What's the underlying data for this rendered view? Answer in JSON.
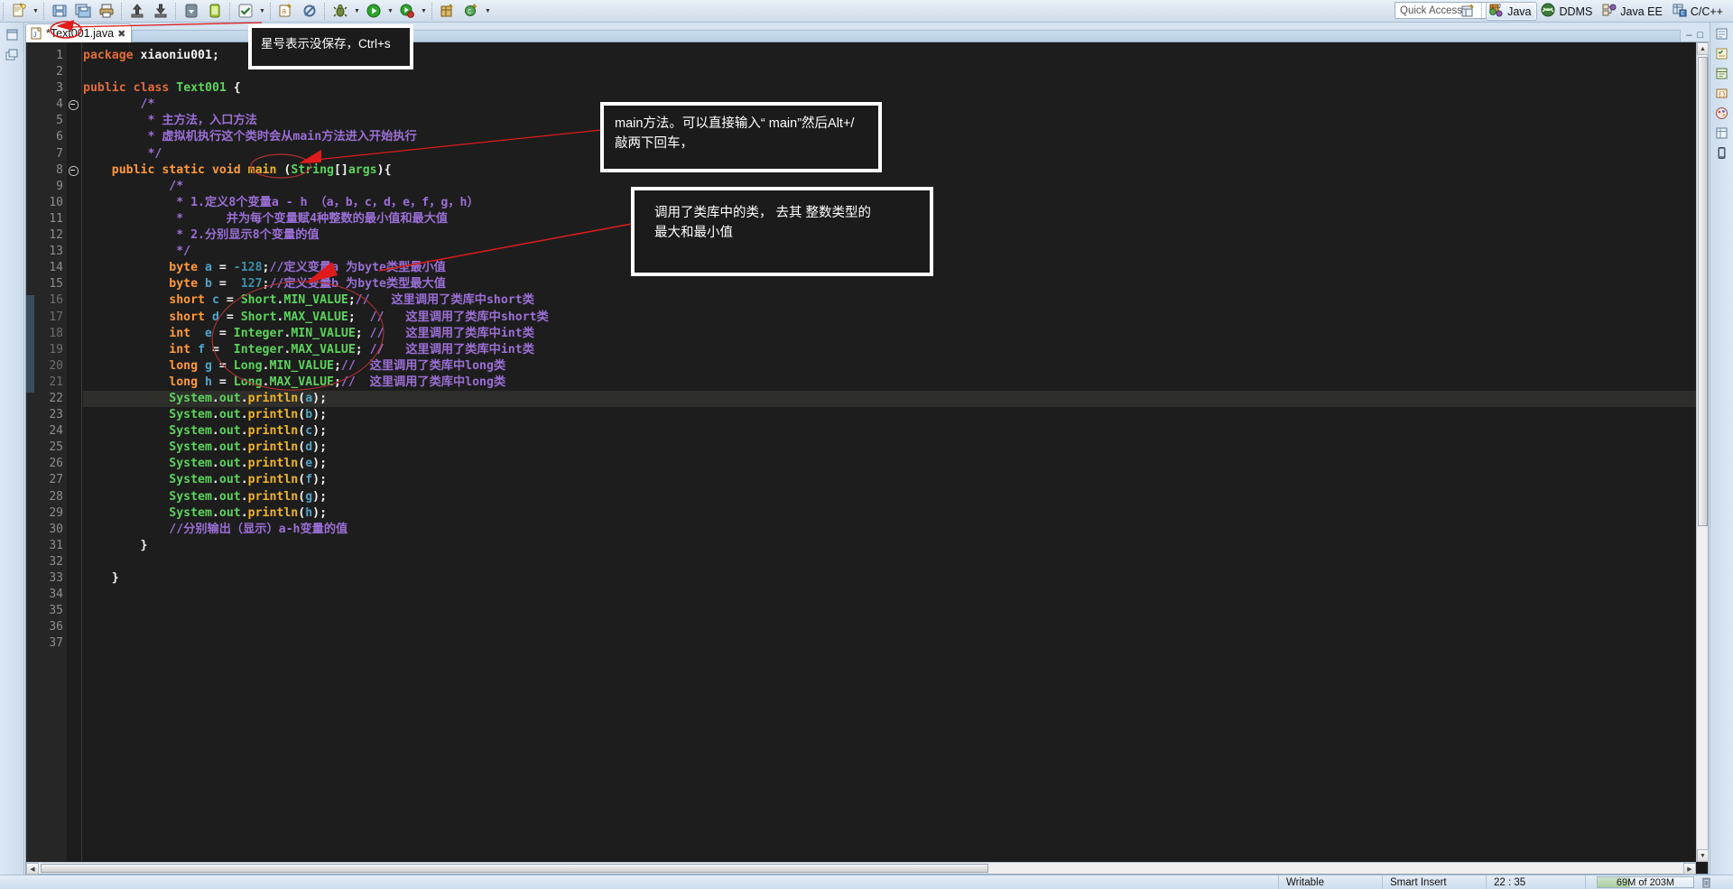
{
  "window": {
    "quick_access_placeholder": "Quick Access"
  },
  "toolbar": {
    "buttons": [
      {
        "name": "new-wizard-icon",
        "label": "New"
      },
      {
        "name": "new-dropdown-icon",
        "label": "New dropdown"
      },
      {
        "name": "save-icon",
        "label": "Save"
      },
      {
        "name": "save-all-icon",
        "label": "Save All"
      },
      {
        "name": "print-icon",
        "label": "Print"
      },
      {
        "name": "export-icon",
        "label": "Export"
      },
      {
        "name": "import-icon",
        "label": "Import"
      },
      {
        "name": "android-sdk-manager-icon",
        "label": "Android SDK Manager"
      },
      {
        "name": "android-virtual-device-manager-icon",
        "label": "Android Virtual Device Manager"
      },
      {
        "name": "build-all-icon",
        "label": "Build All"
      },
      {
        "name": "build-dropdown-icon",
        "label": "Build dropdown"
      },
      {
        "name": "new-android-project-icon",
        "label": "New Android Project"
      },
      {
        "name": "skip-breakpoints-icon",
        "label": "Skip All Breakpoints"
      },
      {
        "name": "debug-icon",
        "label": "Debug"
      },
      {
        "name": "debug-dropdown-icon",
        "label": "Debug dropdown"
      },
      {
        "name": "run-icon",
        "label": "Run"
      },
      {
        "name": "run-dropdown-icon",
        "label": "Run dropdown"
      },
      {
        "name": "run-external-tools-icon",
        "label": "External Tools"
      },
      {
        "name": "external-tools-dropdown-icon",
        "label": "External Tools dropdown"
      },
      {
        "name": "new-java-package-icon",
        "label": "New Java Package"
      },
      {
        "name": "new-java-class-icon",
        "label": "New Java Class"
      },
      {
        "name": "class-dropdown-icon",
        "label": "New Class dropdown"
      }
    ]
  },
  "perspectives": {
    "open_perspective_label": "Open Perspective",
    "items": [
      {
        "label": "Java",
        "icon": "java-perspective-icon",
        "active": true
      },
      {
        "label": "DDMS",
        "icon": "ddms-perspective-icon",
        "active": false
      },
      {
        "label": "Java EE",
        "icon": "javaee-perspective-icon",
        "active": false
      },
      {
        "label": "C/C++",
        "icon": "cpp-perspective-icon",
        "active": false
      }
    ]
  },
  "left_rail": {
    "items": [
      {
        "name": "restore-view-icon",
        "label": "Restore"
      },
      {
        "name": "package-explorer-minimized-icon",
        "label": "Package Explorer"
      }
    ]
  },
  "right_rail": {
    "items": [
      {
        "name": "outline-view-icon",
        "label": "Outline"
      },
      {
        "name": "task-list-icon",
        "label": "Task List"
      },
      {
        "name": "templates-view-icon",
        "label": "Templates"
      },
      {
        "name": "snippets-view-icon",
        "label": "Snippets"
      },
      {
        "name": "palette-view-icon",
        "label": "Palette"
      },
      {
        "name": "properties-view-icon",
        "label": "Properties"
      },
      {
        "name": "device-view-icon",
        "label": "Devices"
      }
    ]
  },
  "editor": {
    "tab": {
      "filename": "*Text001.java",
      "close_label": "✖",
      "icon": "java-file-icon"
    },
    "minimize_label": "–",
    "maximize_label": "□",
    "current_line": 22,
    "lines": [
      {
        "n": 1,
        "segs": [
          {
            "t": "package",
            "c": "kw2"
          },
          {
            "t": " ",
            "c": "pln"
          },
          {
            "t": "xiaoniu001",
            "c": "wht"
          },
          {
            "t": ";",
            "c": "wht"
          }
        ]
      },
      {
        "n": 2,
        "segs": []
      },
      {
        "n": 3,
        "segs": [
          {
            "t": "public",
            "c": "kw2"
          },
          {
            "t": " ",
            "c": "pln"
          },
          {
            "t": "class",
            "c": "kw2"
          },
          {
            "t": " ",
            "c": "pln"
          },
          {
            "t": "Text001",
            "c": "grn"
          },
          {
            "t": " {",
            "c": "wht"
          }
        ]
      },
      {
        "n": 4,
        "fold": true,
        "segs": [
          {
            "t": "\t\t/*",
            "c": "cmt"
          }
        ]
      },
      {
        "n": 5,
        "segs": [
          {
            "t": "\t\t * 主方法，入口方法",
            "c": "cmt"
          }
        ]
      },
      {
        "n": 6,
        "segs": [
          {
            "t": "\t\t * 虚拟机执行这个类时会从main方法进入开始执行",
            "c": "cmt"
          }
        ]
      },
      {
        "n": 7,
        "segs": [
          {
            "t": "\t\t */",
            "c": "cmt"
          }
        ]
      },
      {
        "n": 8,
        "fold": true,
        "segs": [
          {
            "t": "\t",
            "c": "pln"
          },
          {
            "t": "public",
            "c": "kw"
          },
          {
            "t": " ",
            "c": "pln"
          },
          {
            "t": "static",
            "c": "kw"
          },
          {
            "t": " ",
            "c": "pln"
          },
          {
            "t": "void",
            "c": "kw"
          },
          {
            "t": " ",
            "c": "pln"
          },
          {
            "t": "main",
            "c": "mth"
          },
          {
            "t": " (",
            "c": "wht"
          },
          {
            "t": "String",
            "c": "grn"
          },
          {
            "t": "[]",
            "c": "wht"
          },
          {
            "t": "args",
            "c": "grn"
          },
          {
            "t": "){",
            "c": "wht"
          }
        ]
      },
      {
        "n": 9,
        "segs": [
          {
            "t": "\t\t\t/*",
            "c": "cmt"
          }
        ]
      },
      {
        "n": 10,
        "segs": [
          {
            "t": "\t\t\t * 1.定义8个变量a - h （a，b，c，d，e，f，g，h）",
            "c": "cmt"
          }
        ]
      },
      {
        "n": 11,
        "segs": [
          {
            "t": "\t\t\t *      并为每个变量赋4种整数的最小值和最大值",
            "c": "cmt"
          }
        ]
      },
      {
        "n": 12,
        "segs": [
          {
            "t": "\t\t\t * 2.分别显示8个变量的值",
            "c": "cmt"
          }
        ]
      },
      {
        "n": 13,
        "segs": [
          {
            "t": "\t\t\t */",
            "c": "cmt"
          }
        ]
      },
      {
        "n": 14,
        "segs": [
          {
            "t": "\t\t\t",
            "c": "pln"
          },
          {
            "t": "byte",
            "c": "kw"
          },
          {
            "t": " ",
            "c": "pln"
          },
          {
            "t": "a",
            "c": "var"
          },
          {
            "t": " = ",
            "c": "wht"
          },
          {
            "t": "-128",
            "c": "num"
          },
          {
            "t": ";",
            "c": "wht"
          },
          {
            "t": "//定义变量a 为byte类型最小值",
            "c": "cmt"
          }
        ]
      },
      {
        "n": 15,
        "segs": [
          {
            "t": "\t\t\t",
            "c": "pln"
          },
          {
            "t": "byte",
            "c": "kw"
          },
          {
            "t": " ",
            "c": "pln"
          },
          {
            "t": "b",
            "c": "var"
          },
          {
            "t": " =  ",
            "c": "wht"
          },
          {
            "t": "127",
            "c": "num"
          },
          {
            "t": ";",
            "c": "wht"
          },
          {
            "t": "//定义变量b 为byte类型最大值",
            "c": "cmt"
          }
        ]
      },
      {
        "n": 16,
        "segs": [
          {
            "t": "\t\t\t",
            "c": "pln"
          },
          {
            "t": "short",
            "c": "kw"
          },
          {
            "t": " ",
            "c": "pln"
          },
          {
            "t": "c",
            "c": "var"
          },
          {
            "t": " = ",
            "c": "wht"
          },
          {
            "t": "Short",
            "c": "grn"
          },
          {
            "t": ".",
            "c": "wht"
          },
          {
            "t": "MIN_VALUE",
            "c": "grn"
          },
          {
            "t": ";",
            "c": "wht"
          },
          {
            "t": "//   这里调用了类库中short类",
            "c": "cmt"
          }
        ]
      },
      {
        "n": 17,
        "segs": [
          {
            "t": "\t\t\t",
            "c": "pln"
          },
          {
            "t": "short",
            "c": "kw"
          },
          {
            "t": " ",
            "c": "pln"
          },
          {
            "t": "d",
            "c": "var"
          },
          {
            "t": " = ",
            "c": "wht"
          },
          {
            "t": "Short",
            "c": "grn"
          },
          {
            "t": ".",
            "c": "wht"
          },
          {
            "t": "MAX_VALUE",
            "c": "grn"
          },
          {
            "t": ";  ",
            "c": "wht"
          },
          {
            "t": "//   这里调用了类库中short类",
            "c": "cmt"
          }
        ]
      },
      {
        "n": 18,
        "segs": [
          {
            "t": "\t\t\t",
            "c": "pln"
          },
          {
            "t": "int",
            "c": "kw"
          },
          {
            "t": "  ",
            "c": "pln"
          },
          {
            "t": "e",
            "c": "var"
          },
          {
            "t": " = ",
            "c": "wht"
          },
          {
            "t": "Integer",
            "c": "grn"
          },
          {
            "t": ".",
            "c": "wht"
          },
          {
            "t": "MIN_VALUE",
            "c": "grn"
          },
          {
            "t": "; ",
            "c": "wht"
          },
          {
            "t": "//   这里调用了类库中int类",
            "c": "cmt"
          }
        ]
      },
      {
        "n": 19,
        "segs": [
          {
            "t": "\t\t\t",
            "c": "pln"
          },
          {
            "t": "int",
            "c": "kw"
          },
          {
            "t": " ",
            "c": "pln"
          },
          {
            "t": "f",
            "c": "var"
          },
          {
            "t": " =  ",
            "c": "wht"
          },
          {
            "t": "Integer",
            "c": "grn"
          },
          {
            "t": ".",
            "c": "wht"
          },
          {
            "t": "MAX_VALUE",
            "c": "grn"
          },
          {
            "t": "; ",
            "c": "wht"
          },
          {
            "t": "//   这里调用了类库中int类",
            "c": "cmt"
          }
        ]
      },
      {
        "n": 20,
        "segs": [
          {
            "t": "\t\t\t",
            "c": "pln"
          },
          {
            "t": "long",
            "c": "kw"
          },
          {
            "t": " ",
            "c": "pln"
          },
          {
            "t": "g",
            "c": "var"
          },
          {
            "t": " = ",
            "c": "wht"
          },
          {
            "t": "Long",
            "c": "grn"
          },
          {
            "t": ".",
            "c": "wht"
          },
          {
            "t": "MIN_VALUE",
            "c": "grn"
          },
          {
            "t": ";",
            "c": "wht"
          },
          {
            "t": "//  这里调用了类库中long类",
            "c": "cmt"
          }
        ]
      },
      {
        "n": 21,
        "segs": [
          {
            "t": "\t\t\t",
            "c": "pln"
          },
          {
            "t": "long",
            "c": "kw"
          },
          {
            "t": " ",
            "c": "pln"
          },
          {
            "t": "h",
            "c": "var"
          },
          {
            "t": " = ",
            "c": "wht"
          },
          {
            "t": "Long",
            "c": "grn"
          },
          {
            "t": ".",
            "c": "wht"
          },
          {
            "t": "MAX_VALUE",
            "c": "grn"
          },
          {
            "t": ";",
            "c": "wht"
          },
          {
            "t": "//  这里调用了类库中long类",
            "c": "cmt"
          }
        ]
      },
      {
        "n": 22,
        "cur": true,
        "segs": [
          {
            "t": "\t\t\t",
            "c": "pln"
          },
          {
            "t": "System",
            "c": "grn"
          },
          {
            "t": ".",
            "c": "wht"
          },
          {
            "t": "out",
            "c": "grn"
          },
          {
            "t": ".",
            "c": "wht"
          },
          {
            "t": "println",
            "c": "mth"
          },
          {
            "t": "(",
            "c": "wht"
          },
          {
            "t": "a",
            "c": "var"
          },
          {
            "t": ");",
            "c": "wht"
          }
        ]
      },
      {
        "n": 23,
        "segs": [
          {
            "t": "\t\t\t",
            "c": "pln"
          },
          {
            "t": "System",
            "c": "grn"
          },
          {
            "t": ".",
            "c": "wht"
          },
          {
            "t": "out",
            "c": "grn"
          },
          {
            "t": ".",
            "c": "wht"
          },
          {
            "t": "println",
            "c": "mth"
          },
          {
            "t": "(",
            "c": "wht"
          },
          {
            "t": "b",
            "c": "var"
          },
          {
            "t": ");",
            "c": "wht"
          }
        ]
      },
      {
        "n": 24,
        "segs": [
          {
            "t": "\t\t\t",
            "c": "pln"
          },
          {
            "t": "System",
            "c": "grn"
          },
          {
            "t": ".",
            "c": "wht"
          },
          {
            "t": "out",
            "c": "grn"
          },
          {
            "t": ".",
            "c": "wht"
          },
          {
            "t": "println",
            "c": "mth"
          },
          {
            "t": "(",
            "c": "wht"
          },
          {
            "t": "c",
            "c": "var"
          },
          {
            "t": ");",
            "c": "wht"
          }
        ]
      },
      {
        "n": 25,
        "segs": [
          {
            "t": "\t\t\t",
            "c": "pln"
          },
          {
            "t": "System",
            "c": "grn"
          },
          {
            "t": ".",
            "c": "wht"
          },
          {
            "t": "out",
            "c": "grn"
          },
          {
            "t": ".",
            "c": "wht"
          },
          {
            "t": "println",
            "c": "mth"
          },
          {
            "t": "(",
            "c": "wht"
          },
          {
            "t": "d",
            "c": "var"
          },
          {
            "t": ");",
            "c": "wht"
          }
        ]
      },
      {
        "n": 26,
        "segs": [
          {
            "t": "\t\t\t",
            "c": "pln"
          },
          {
            "t": "System",
            "c": "grn"
          },
          {
            "t": ".",
            "c": "wht"
          },
          {
            "t": "out",
            "c": "grn"
          },
          {
            "t": ".",
            "c": "wht"
          },
          {
            "t": "println",
            "c": "mth"
          },
          {
            "t": "(",
            "c": "wht"
          },
          {
            "t": "e",
            "c": "var"
          },
          {
            "t": ");",
            "c": "wht"
          }
        ]
      },
      {
        "n": 27,
        "segs": [
          {
            "t": "\t\t\t",
            "c": "pln"
          },
          {
            "t": "System",
            "c": "grn"
          },
          {
            "t": ".",
            "c": "wht"
          },
          {
            "t": "out",
            "c": "grn"
          },
          {
            "t": ".",
            "c": "wht"
          },
          {
            "t": "println",
            "c": "mth"
          },
          {
            "t": "(",
            "c": "wht"
          },
          {
            "t": "f",
            "c": "var"
          },
          {
            "t": ");",
            "c": "wht"
          }
        ]
      },
      {
        "n": 28,
        "segs": [
          {
            "t": "\t\t\t",
            "c": "pln"
          },
          {
            "t": "System",
            "c": "grn"
          },
          {
            "t": ".",
            "c": "wht"
          },
          {
            "t": "out",
            "c": "grn"
          },
          {
            "t": ".",
            "c": "wht"
          },
          {
            "t": "println",
            "c": "mth"
          },
          {
            "t": "(",
            "c": "wht"
          },
          {
            "t": "g",
            "c": "var"
          },
          {
            "t": ");",
            "c": "wht"
          }
        ]
      },
      {
        "n": 29,
        "segs": [
          {
            "t": "\t\t\t",
            "c": "pln"
          },
          {
            "t": "System",
            "c": "grn"
          },
          {
            "t": ".",
            "c": "wht"
          },
          {
            "t": "out",
            "c": "grn"
          },
          {
            "t": ".",
            "c": "wht"
          },
          {
            "t": "println",
            "c": "mth"
          },
          {
            "t": "(",
            "c": "wht"
          },
          {
            "t": "h",
            "c": "var"
          },
          {
            "t": ");",
            "c": "wht"
          }
        ]
      },
      {
        "n": 30,
        "segs": [
          {
            "t": "\t\t\t//分别输出（显示）a-h变量的值",
            "c": "cmt"
          }
        ]
      },
      {
        "n": 31,
        "segs": [
          {
            "t": "\t\t}",
            "c": "wht"
          }
        ]
      },
      {
        "n": 32,
        "segs": []
      },
      {
        "n": 33,
        "segs": [
          {
            "t": "\t}",
            "c": "wht"
          }
        ]
      },
      {
        "n": 34,
        "segs": []
      },
      {
        "n": 35,
        "segs": []
      },
      {
        "n": 36,
        "segs": []
      },
      {
        "n": 37,
        "segs": []
      }
    ]
  },
  "annotations": [
    {
      "id": "a1",
      "text": "星号表示没保存，Ctrl+s"
    },
    {
      "id": "a2",
      "text": "main方法。可以直接输入“ main”然后Alt+/\n敲两下回车，"
    },
    {
      "id": "a3",
      "text": "调用了类库中的类， 去其 整数类型的\n最大和最小值"
    }
  ],
  "statusbar": {
    "writable": "Writable",
    "insert_mode": "Smart Insert",
    "cursor_position": "22 : 35",
    "memory": "69M of 203M",
    "memory_percent": 34,
    "trash_icon": "trash-icon"
  },
  "colors": {
    "annotation_red": "#e01b1b",
    "chrome_blue": "#cddcec",
    "editor_bg": "#1d1d1d"
  }
}
